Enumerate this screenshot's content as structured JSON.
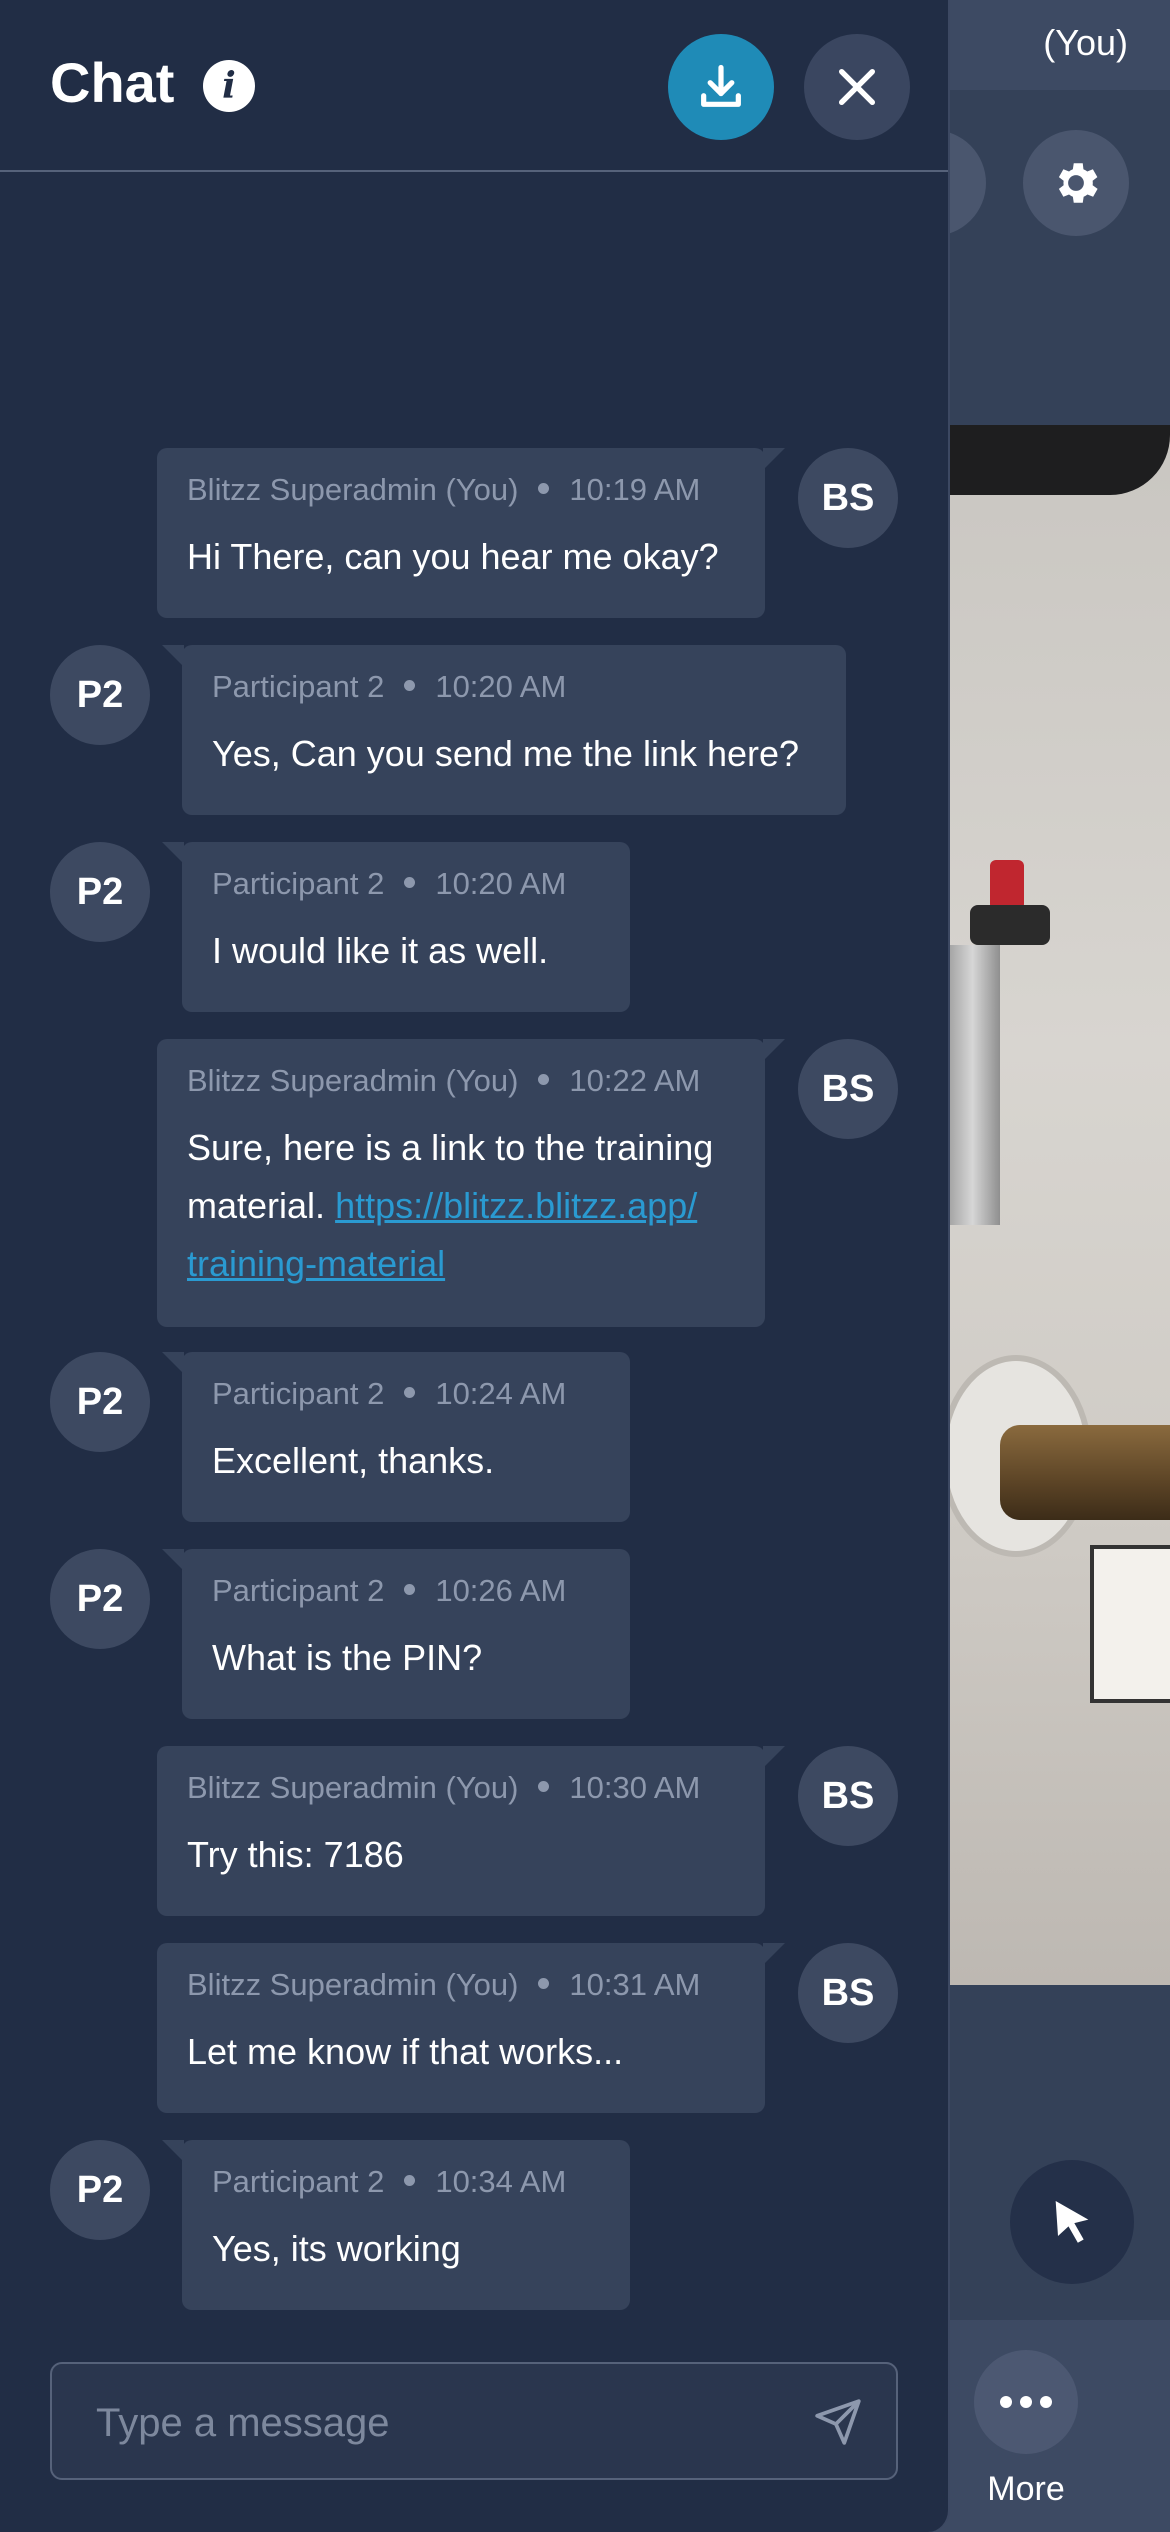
{
  "background": {
    "self_label": "(You)",
    "more_label": "More"
  },
  "chat": {
    "title": "Chat",
    "info_glyph": "i",
    "composer_placeholder": "Type a message",
    "messages": [
      {
        "side": "you",
        "initials": "BS",
        "sender": "Blitzz Superadmin (You)",
        "time": "10:19 AM",
        "text": "Hi There, can you hear me okay?"
      },
      {
        "side": "other",
        "initials": "P2",
        "sender": "Participant 2",
        "time": "10:20 AM",
        "text": "Yes, Can you send me the link here?"
      },
      {
        "side": "other",
        "initials": "P2",
        "sender": "Participant 2",
        "time": "10:20 AM",
        "text": "I would like it as well."
      },
      {
        "side": "you",
        "initials": "BS",
        "sender": "Blitzz Superadmin (You)",
        "time": "10:22 AM",
        "text": "Sure, here is a link to the training material.",
        "link": "https://blitzz.blitzz.app/training-material",
        "link_line1": "https://blitzz.blitzz.app/",
        "link_line2": "training-material"
      },
      {
        "side": "other",
        "initials": "P2",
        "sender": "Participant 2",
        "time": "10:24 AM",
        "text": "Excellent, thanks."
      },
      {
        "side": "other",
        "initials": "P2",
        "sender": "Participant 2",
        "time": "10:26 AM",
        "text": "What is the PIN?"
      },
      {
        "side": "you",
        "initials": "BS",
        "sender": "Blitzz Superadmin (You)",
        "time": "10:30 AM",
        "text": "Try this: 7186"
      },
      {
        "side": "you",
        "initials": "BS",
        "sender": "Blitzz Superadmin (You)",
        "time": "10:31 AM",
        "text": "Let me know if that works..."
      },
      {
        "side": "other",
        "initials": "P2",
        "sender": "Participant 2",
        "time": "10:34 AM",
        "text": "Yes, its working"
      }
    ]
  },
  "colors": {
    "panel_bg": "#212d45",
    "bubble_bg": "#36435b",
    "accent": "#1f8bb7",
    "link": "#2a9ad1"
  },
  "icons": [
    "info-icon",
    "download-icon",
    "close-icon",
    "accessibility-icon",
    "gear-icon",
    "pointer-icon",
    "more-icon",
    "send-icon"
  ]
}
